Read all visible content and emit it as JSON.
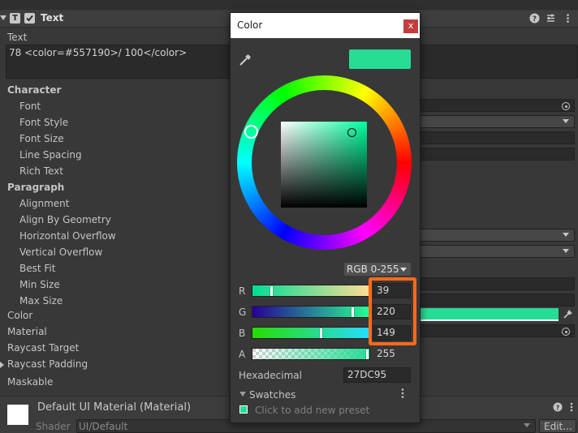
{
  "component": {
    "title": "Text"
  },
  "text_section": {
    "label": "Text",
    "value": "78 <color=#557190>/ 100</color>"
  },
  "character": {
    "heading": "Character",
    "items": [
      "Font",
      "Font Style",
      "Font Size",
      "Line Spacing",
      "Rich Text"
    ]
  },
  "paragraph": {
    "heading": "Paragraph",
    "items": [
      "Alignment",
      "Align By Geometry",
      "Horizontal Overflow",
      "Vertical Overflow",
      "Best Fit",
      "Min Size",
      "Max Size"
    ]
  },
  "props": {
    "color": "Color",
    "material": "Material",
    "raycast_target": "Raycast Target",
    "raycast_padding": "Raycast Padding",
    "maskable": "Maskable"
  },
  "material_footer": {
    "name": "Default UI Material (Material)",
    "shader_label": "Shader",
    "shader_value": "UI/Default",
    "edit_label": "Edit..."
  },
  "color_picker": {
    "title": "Color",
    "close": "x",
    "mode": "RGB 0-255",
    "hex_label": "Hexadecimal",
    "hex_value": "27DC95",
    "channels": [
      {
        "label": "R",
        "value": "39"
      },
      {
        "label": "G",
        "value": "220"
      },
      {
        "label": "B",
        "value": "149"
      },
      {
        "label": "A",
        "value": "255"
      }
    ],
    "swatches_label": "Swatches",
    "swatches_hint": "Click to add new preset",
    "current_color": "#27DC95",
    "highlight_color": "#ff6a1a"
  }
}
